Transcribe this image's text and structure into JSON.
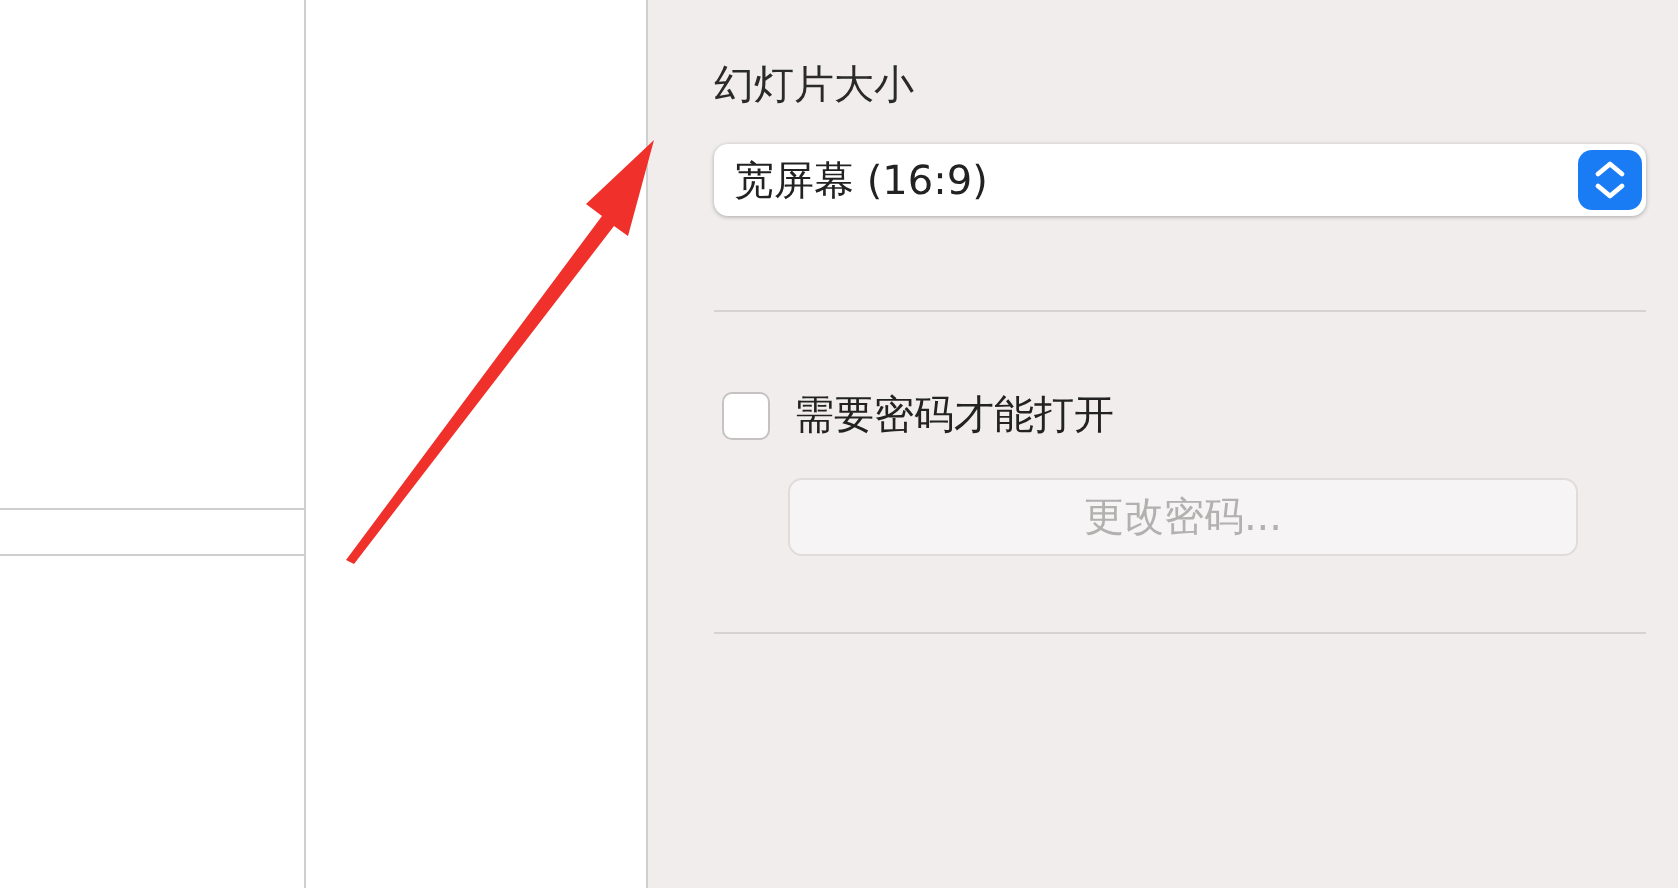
{
  "slide_size": {
    "label": "幻灯片大小",
    "value": "宽屏幕 (16:9)"
  },
  "password": {
    "label": "需要密码才能打开",
    "checked": false
  },
  "change_password_button": {
    "label": "更改密码...",
    "disabled": true
  }
}
